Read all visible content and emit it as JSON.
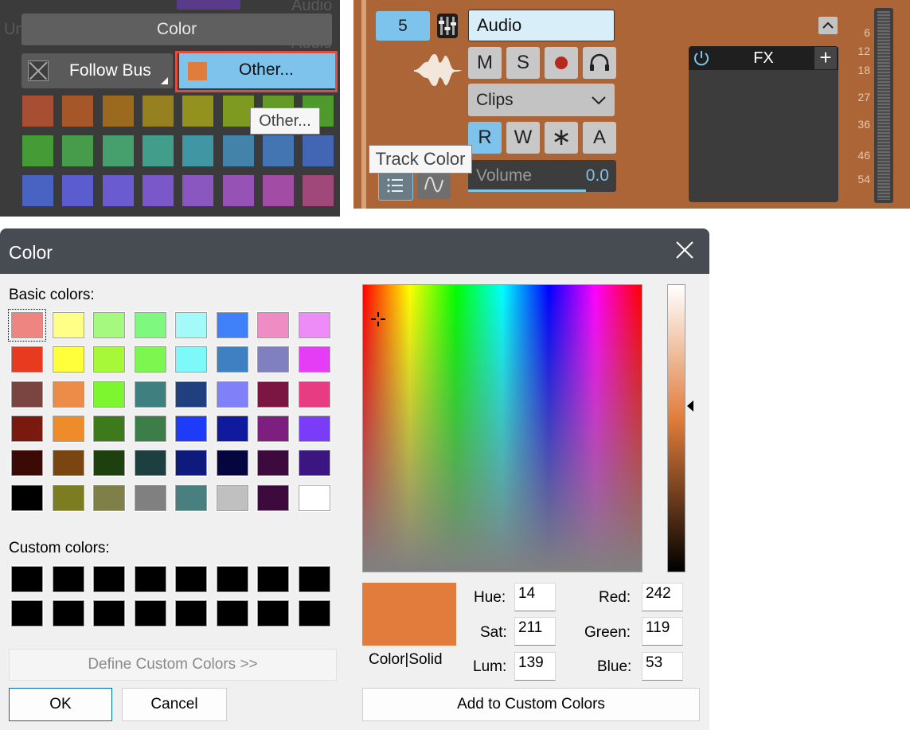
{
  "colors": {
    "accent_blue": "#7dc3ec",
    "track_orange": "#ac6537",
    "selected_color": "#e27c3c",
    "highlight_red": "#e14c3f"
  },
  "popup": {
    "background_texts": [
      "Untitled",
      "Audio",
      "Audio",
      "Audio"
    ],
    "header": "Color",
    "follow_bus": "Follow Bus",
    "other_button": "Other...",
    "tooltip": "Other...",
    "swatches": [
      "#a84f33",
      "#a5572a",
      "#9c6a1f",
      "#96801f",
      "#94921f",
      "#7f9a21",
      "#639b26",
      "#4e9a2d",
      "#459b36",
      "#469c4a",
      "#45a06e",
      "#439d8b",
      "#4097a3",
      "#4383a9",
      "#4375b3",
      "#4266b3",
      "#4863c1",
      "#5a5cd0",
      "#6b5bd0",
      "#7a58ca",
      "#8a57c1",
      "#9652b5",
      "#a24ca6",
      "#a0487a"
    ]
  },
  "track": {
    "number": "5",
    "name": "Audio",
    "mute": "M",
    "solo": "S",
    "clips": "Clips",
    "read": "R",
    "write": "W",
    "asterisk": "∗",
    "auto": "A",
    "volume_label": "Volume",
    "volume_value": "0.0",
    "tooltip": "Track Color",
    "fx_label": "FX",
    "fx_add": "+",
    "meter_scale": [
      "6",
      "12",
      "18",
      "27",
      "36",
      "46",
      "54"
    ]
  },
  "dialog": {
    "title": "Color",
    "basic_colors_label": "Basic colors:",
    "custom_colors_label": "Custom colors:",
    "define_custom": "Define Custom Colors >>",
    "ok": "OK",
    "cancel": "Cancel",
    "add_custom": "Add to Custom Colors",
    "color_solid": "Color|Solid",
    "hue_label": "Hue:",
    "sat_label": "Sat:",
    "lum_label": "Lum:",
    "red_label": "Red:",
    "green_label": "Green:",
    "blue_label": "Blue:",
    "hue": "14",
    "sat": "211",
    "lum": "139",
    "red": "242",
    "green": "119",
    "blue": "53",
    "basic_colors": [
      "#ee8580",
      "#ffff88",
      "#a6f97f",
      "#7ef87f",
      "#a4f9f9",
      "#4080f8",
      "#ee8cc3",
      "#ee8cf7",
      "#e83a1f",
      "#ffff3b",
      "#a6f839",
      "#7ef650",
      "#7ef9f9",
      "#3f80c2",
      "#8080c0",
      "#e53cf5",
      "#7a4540",
      "#ec8c48",
      "#7ef62f",
      "#3f7f7f",
      "#1f3f7f",
      "#8080f9",
      "#7b1642",
      "#e73c82",
      "#7a1a0e",
      "#ef8c2a",
      "#3d7a1c",
      "#3d7d47",
      "#1e3cf8",
      "#0f1a9f",
      "#7c1f7f",
      "#7a3cf6",
      "#3c0a04",
      "#7a4510",
      "#1e3f0e",
      "#1e3f3f",
      "#0f1a7f",
      "#050540",
      "#3c0a3c",
      "#3c1680",
      "#000000",
      "#7c7c20",
      "#7f7f48",
      "#808080",
      "#4a7f7f",
      "#c0c0c0",
      "#3c0a3c",
      "#ffffff"
    ],
    "custom_colors": [
      "#000000",
      "#000000",
      "#000000",
      "#000000",
      "#000000",
      "#000000",
      "#000000",
      "#000000",
      "#000000",
      "#000000",
      "#000000",
      "#000000",
      "#000000",
      "#000000",
      "#000000",
      "#000000"
    ]
  }
}
